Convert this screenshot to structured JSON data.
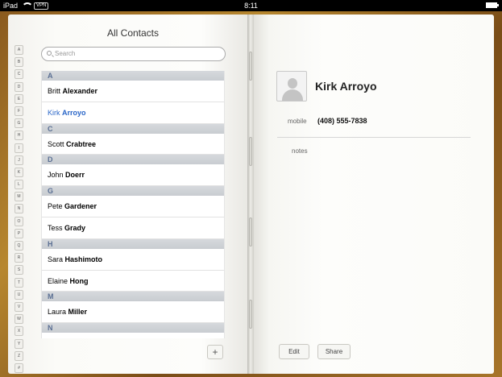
{
  "status_bar": {
    "device": "iPad",
    "vpn": "VPN",
    "time": "8:11"
  },
  "contacts_list": {
    "title": "All Contacts",
    "search_placeholder": "Search",
    "index_letters": [
      "A",
      "B",
      "C",
      "D",
      "E",
      "F",
      "G",
      "H",
      "I",
      "J",
      "K",
      "L",
      "M",
      "N",
      "O",
      "P",
      "Q",
      "R",
      "S",
      "T",
      "U",
      "V",
      "W",
      "X",
      "Y",
      "Z",
      "#"
    ],
    "sections": [
      {
        "header": "A",
        "rows": [
          {
            "first": "Britt",
            "last": "Alexander",
            "selected": false
          },
          {
            "first": "Kirk",
            "last": "Arroyo",
            "selected": true
          }
        ]
      },
      {
        "header": "C",
        "rows": [
          {
            "first": "Scott",
            "last": "Crabtree",
            "selected": false
          }
        ]
      },
      {
        "header": "D",
        "rows": [
          {
            "first": "John",
            "last": "Doerr",
            "selected": false
          }
        ]
      },
      {
        "header": "G",
        "rows": [
          {
            "first": "Pete",
            "last": "Gardener",
            "selected": false
          },
          {
            "first": "Tess",
            "last": "Grady",
            "selected": false
          }
        ]
      },
      {
        "header": "H",
        "rows": [
          {
            "first": "Sara",
            "last": "Hashimoto",
            "selected": false
          },
          {
            "first": "Elaine",
            "last": "Hong",
            "selected": false
          }
        ]
      },
      {
        "header": "M",
        "rows": [
          {
            "first": "Laura",
            "last": "Miller",
            "selected": false
          }
        ]
      },
      {
        "header": "N",
        "rows": []
      }
    ],
    "add_label": "+"
  },
  "detail": {
    "name": "Kirk Arroyo",
    "phone_label": "mobile",
    "phone_value": "(408) 555-7838",
    "notes_label": "notes",
    "edit_label": "Edit",
    "share_label": "Share"
  },
  "colors": {
    "selected_text": "#2a66c8",
    "section_text": "#5a6f93",
    "cover": "#a7752a"
  }
}
